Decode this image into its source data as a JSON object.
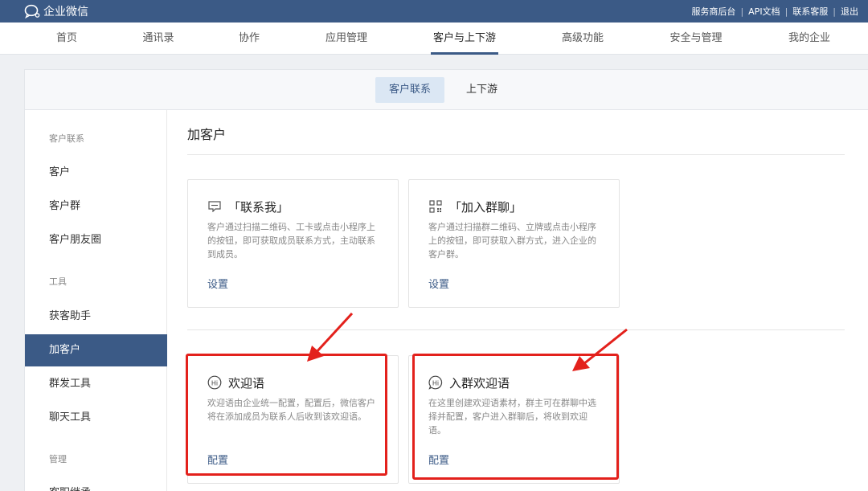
{
  "app": {
    "brand_name": "企业微信",
    "top_links": [
      "服务商后台",
      "API文档",
      "联系客服",
      "退出"
    ]
  },
  "nav": {
    "items": [
      "首页",
      "通讯录",
      "协作",
      "应用管理",
      "客户与上下游",
      "高级功能",
      "安全与管理",
      "我的企业"
    ],
    "active": "客户与上下游"
  },
  "subtabs": {
    "items": [
      "客户联系",
      "上下游"
    ],
    "active": "客户联系"
  },
  "sidebar": {
    "group_customer": "客户联系",
    "item_customer": "客户",
    "item_customer_group": "客户群",
    "item_moments": "客户朋友圈",
    "group_tools": "工具",
    "item_acquire": "获客助手",
    "item_add_customer": "加客户",
    "item_mass_send": "群发工具",
    "item_chat_tools": "聊天工具",
    "group_manage": "管理",
    "item_partial": "客职继承"
  },
  "main": {
    "title": "加客户",
    "cards": {
      "contact_me": {
        "title": "「联系我」",
        "desc": "客户通过扫描二维码、工卡或点击小程序上的按钮，即可获取成员联系方式，主动联系到成员。",
        "link": "设置",
        "icon": "chat-bubble-icon"
      },
      "join_group": {
        "title": "「加入群聊」",
        "desc": "客户通过扫描群二维码、立牌或点击小程序上的按钮，即可获取入群方式，进入企业的客户群。",
        "link": "设置",
        "icon": "qr-code-icon"
      },
      "welcome": {
        "title": "欢迎语",
        "desc": "欢迎语由企业统一配置，配置后，微信客户将在添加成员为联系人后收到该欢迎语。",
        "link": "配置",
        "icon": "hi-icon"
      },
      "group_welcome": {
        "title": "入群欢迎语",
        "desc": "在这里创建欢迎语素材，群主可在群聊中选择并配置，客户进入群聊后，将收到欢迎语。",
        "link": "配置",
        "icon": "hi-bubble-icon"
      }
    }
  },
  "colors": {
    "brand": "#3b5a86",
    "highlight": "#e3211c",
    "active_tab_bg": "#dbe7f4"
  }
}
